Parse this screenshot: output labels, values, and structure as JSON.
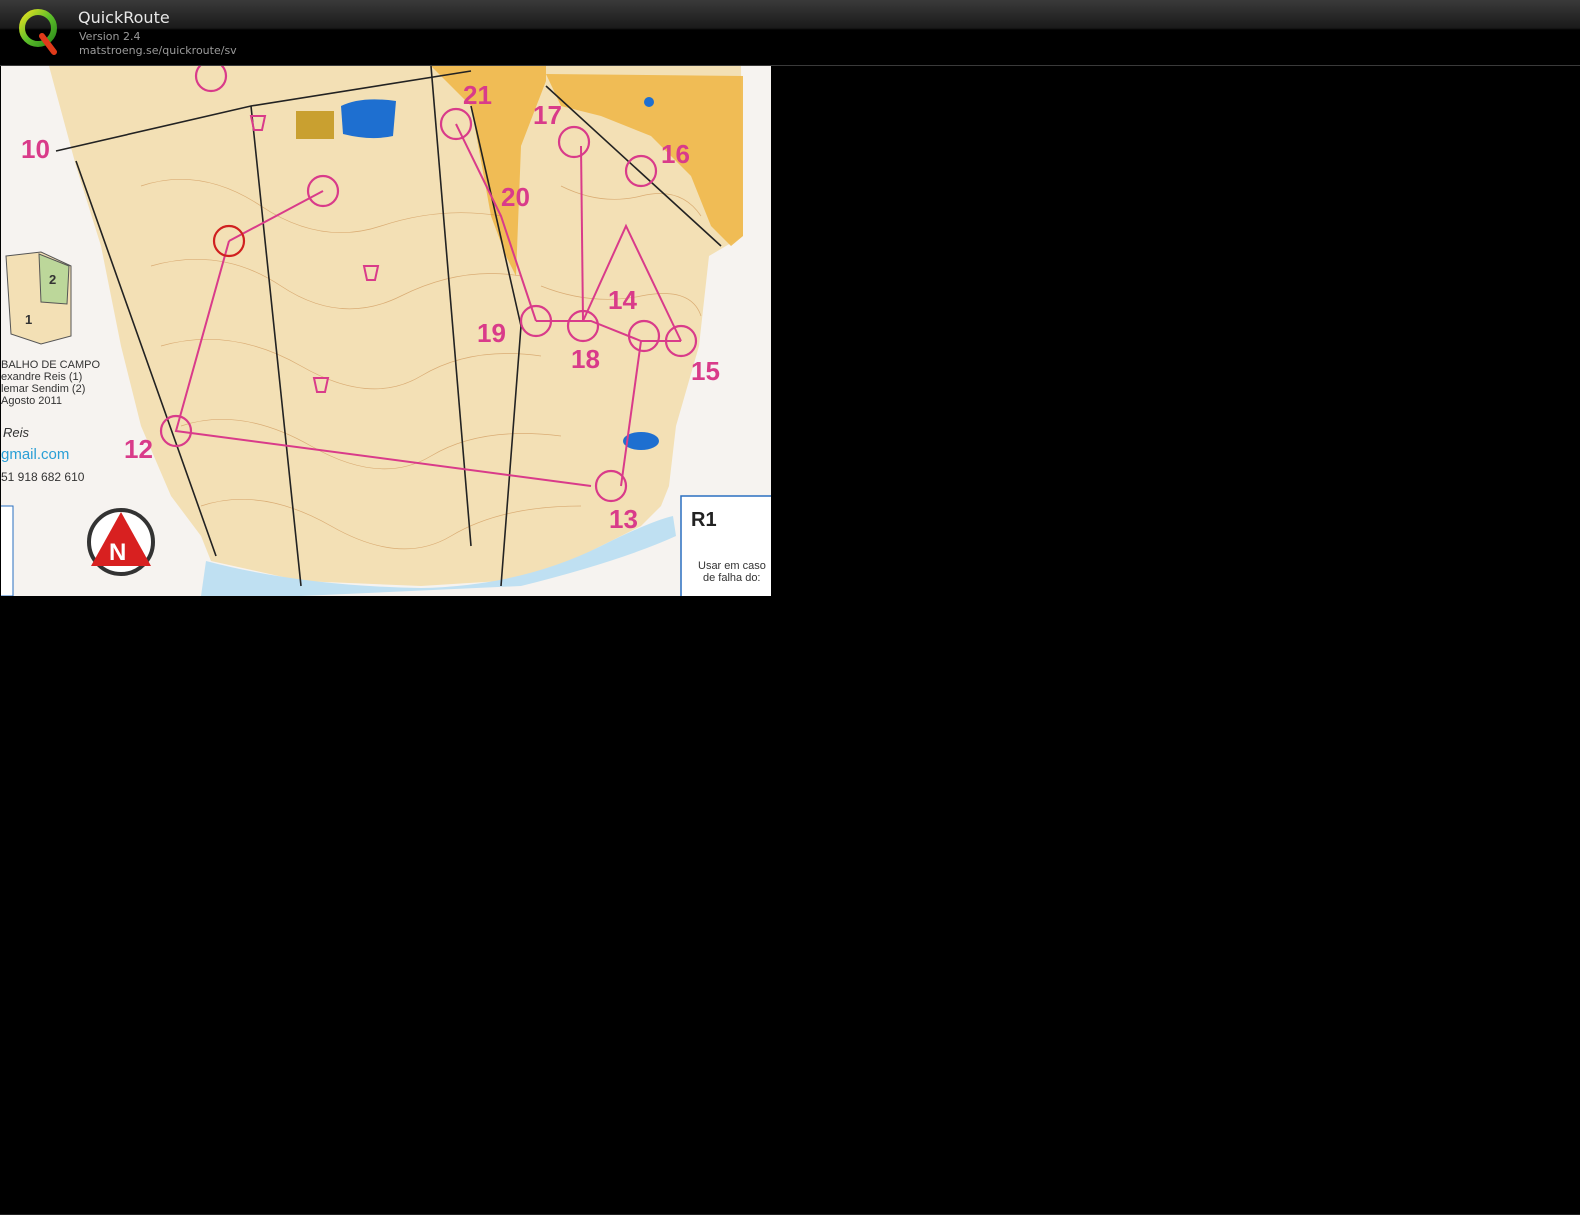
{
  "app": {
    "title": "QuickRoute",
    "version": "Version 2.4",
    "url": "matstroeng.se/quickroute/sv"
  },
  "map": {
    "controls": [
      "10",
      "12",
      "13",
      "14",
      "15",
      "16",
      "17",
      "18",
      "19",
      "20",
      "21"
    ],
    "inset_labels": [
      "1",
      "2"
    ],
    "credits": [
      "BALHO DE CAMPO",
      "exandre Reis (1)",
      "lemar Sendim (2)",
      "Agosto 2011"
    ],
    "author": "Reis",
    "email": "gmail.com",
    "phone": "51 918 682 610",
    "legend_code": "R1",
    "legend_note_1": "Usar em caso",
    "legend_note_2": "de falha do:",
    "north_letter": "N",
    "colors": {
      "control": "#d93b8a",
      "terrain": "#f3e3bf",
      "urban": "#f0b84a",
      "water": "#1e6fd0"
    }
  }
}
